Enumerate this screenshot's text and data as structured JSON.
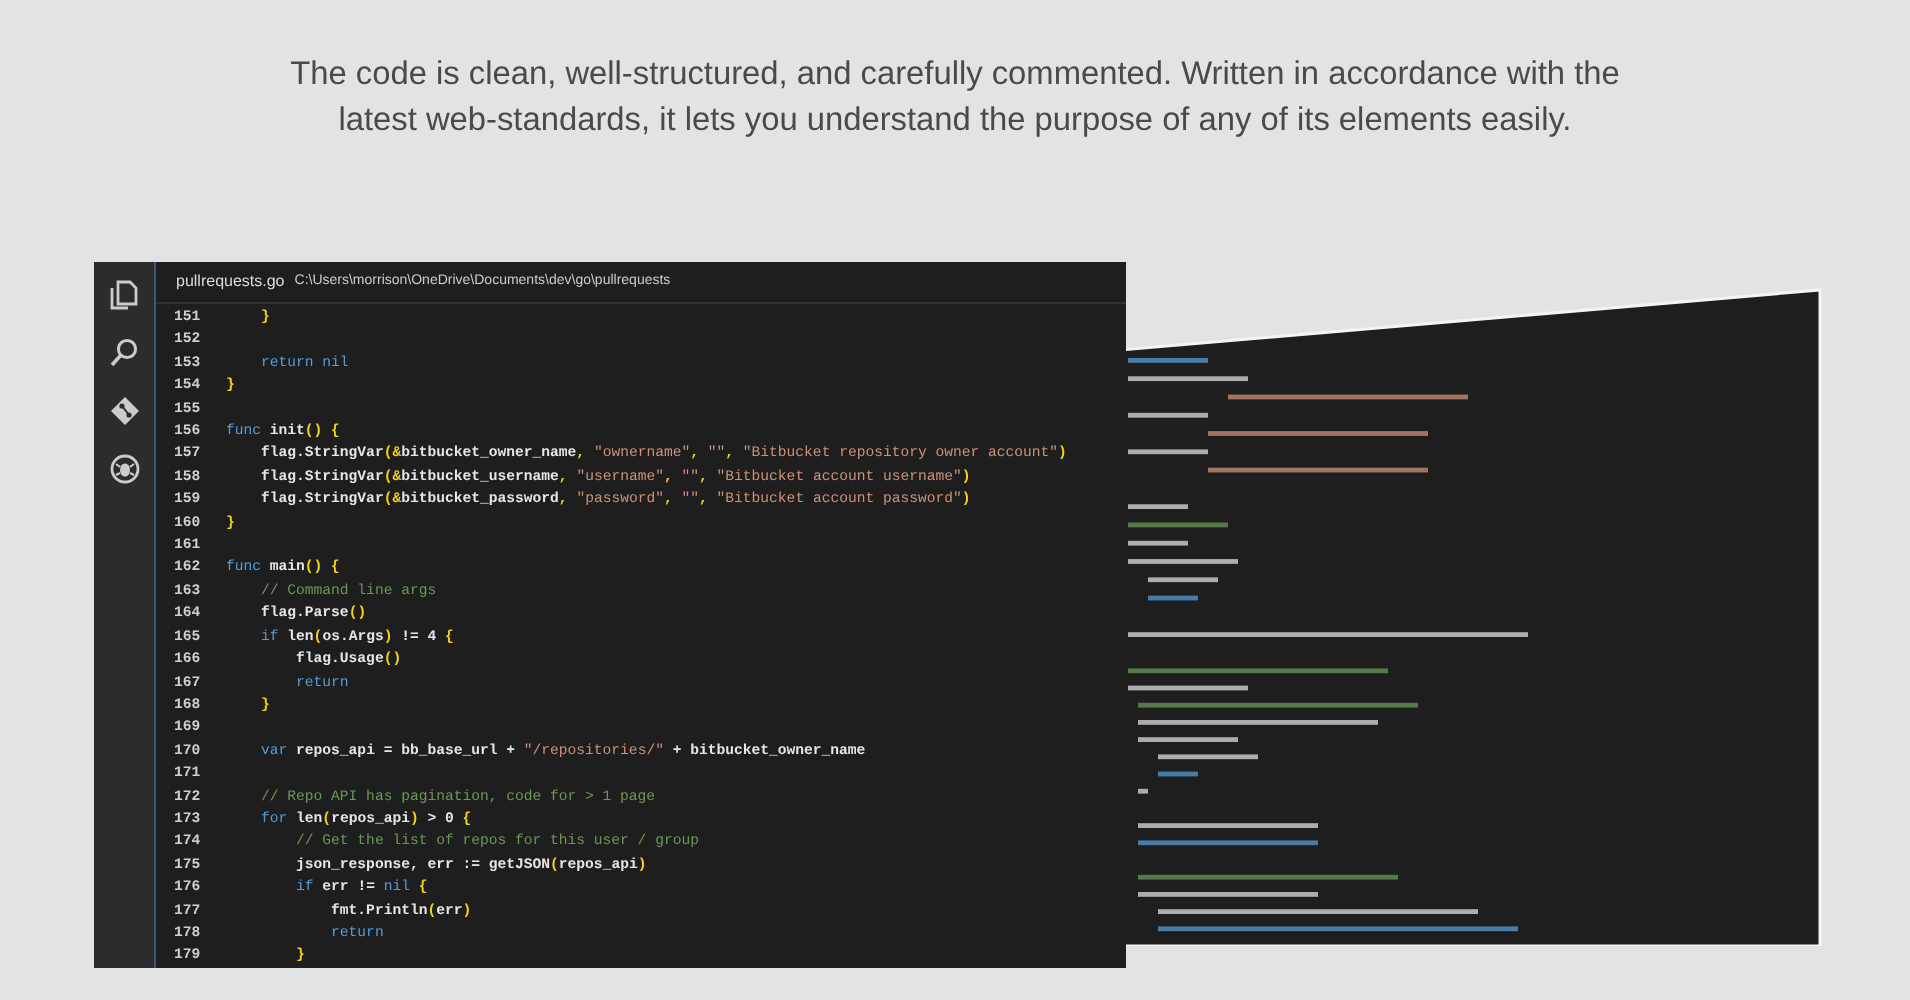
{
  "intro": "The code is clean, well-structured, and carefully commented. Written in accordance with the latest web-standards, it lets you understand the purpose of any of its elements easily.",
  "editor": {
    "file_name": "pullrequests.go",
    "file_path": "C:\\Users\\morrison\\OneDrive\\Documents\\dev\\go\\pullrequests",
    "code_lines": [
      {
        "number": "151",
        "tokens": [
          {
            "kind": "bracket",
            "text": "    }"
          }
        ]
      },
      {
        "number": "152"
      },
      {
        "number": "153",
        "tokens": [
          {
            "kind": "keyword",
            "text": "    return nil"
          }
        ]
      },
      {
        "number": "154",
        "tokens": [
          {
            "kind": "bracket",
            "text": "}"
          }
        ]
      },
      {
        "number": "155"
      },
      {
        "number": "156",
        "tokens": [
          {
            "kind": "keyword",
            "text": "func"
          },
          {
            "kind": "plain",
            "text": " init"
          },
          {
            "kind": "bracket",
            "text": "() {"
          }
        ]
      },
      {
        "number": "157",
        "tokens": [
          {
            "kind": "plain",
            "text": "    flag.StringVar"
          },
          {
            "kind": "bracket",
            "text": "(&"
          },
          {
            "kind": "plain",
            "text": "bitbucket_owner_name"
          },
          {
            "kind": "bracket",
            "text": ", "
          },
          {
            "kind": "string",
            "text": "\"ownername\""
          },
          {
            "kind": "bracket",
            "text": ", "
          },
          {
            "kind": "string",
            "text": "\"\""
          },
          {
            "kind": "bracket",
            "text": ", "
          },
          {
            "kind": "string",
            "text": "\"Bitbucket repository owner account\""
          },
          {
            "kind": "bracket",
            "text": ")"
          }
        ]
      },
      {
        "number": "158",
        "tokens": [
          {
            "kind": "plain",
            "text": "    flag.StringVar"
          },
          {
            "kind": "bracket",
            "text": "(&"
          },
          {
            "kind": "plain",
            "text": "bitbucket_username"
          },
          {
            "kind": "bracket",
            "text": ", "
          },
          {
            "kind": "string",
            "text": "\"username\""
          },
          {
            "kind": "bracket",
            "text": ", "
          },
          {
            "kind": "string",
            "text": "\"\""
          },
          {
            "kind": "bracket",
            "text": ", "
          },
          {
            "kind": "string",
            "text": "\"Bitbucket account username\""
          },
          {
            "kind": "bracket",
            "text": ")"
          }
        ]
      },
      {
        "number": "159",
        "tokens": [
          {
            "kind": "plain",
            "text": "    flag.StringVar"
          },
          {
            "kind": "bracket",
            "text": "(&"
          },
          {
            "kind": "plain",
            "text": "bitbucket_password"
          },
          {
            "kind": "bracket",
            "text": ", "
          },
          {
            "kind": "string",
            "text": "\"password\""
          },
          {
            "kind": "bracket",
            "text": ", "
          },
          {
            "kind": "string",
            "text": "\"\""
          },
          {
            "kind": "bracket",
            "text": ", "
          },
          {
            "kind": "string",
            "text": "\"Bitbucket account password\""
          },
          {
            "kind": "bracket",
            "text": ")"
          }
        ]
      },
      {
        "number": "160",
        "tokens": [
          {
            "kind": "bracket",
            "text": "}"
          }
        ]
      },
      {
        "number": "161"
      },
      {
        "number": "162",
        "tokens": [
          {
            "kind": "keyword",
            "text": "func"
          },
          {
            "kind": "plain",
            "text": " main"
          },
          {
            "kind": "bracket",
            "text": "() {"
          }
        ]
      },
      {
        "number": "163",
        "tokens": [
          {
            "kind": "comment",
            "text": "    // Command line args"
          }
        ]
      },
      {
        "number": "164",
        "tokens": [
          {
            "kind": "plain",
            "text": "    flag.Parse"
          },
          {
            "kind": "bracket",
            "text": "()"
          }
        ]
      },
      {
        "number": "165",
        "tokens": [
          {
            "kind": "keyword",
            "text": "    if"
          },
          {
            "kind": "plain",
            "text": " len"
          },
          {
            "kind": "bracket",
            "text": "("
          },
          {
            "kind": "plain",
            "text": "os.Args"
          },
          {
            "kind": "bracket",
            "text": ")"
          },
          {
            "kind": "plain",
            "text": " != 4 "
          },
          {
            "kind": "bracket",
            "text": "{"
          }
        ]
      },
      {
        "number": "166",
        "tokens": [
          {
            "kind": "plain",
            "text": "        flag.Usage"
          },
          {
            "kind": "bracket",
            "text": "()"
          }
        ]
      },
      {
        "number": "167",
        "tokens": [
          {
            "kind": "keyword",
            "text": "        return"
          }
        ]
      },
      {
        "number": "168",
        "tokens": [
          {
            "kind": "bracket",
            "text": "    }"
          }
        ]
      },
      {
        "number": "169"
      },
      {
        "number": "170",
        "tokens": [
          {
            "kind": "keyword",
            "text": "    var"
          },
          {
            "kind": "plain",
            "text": " repos_api = bb_base_url + "
          },
          {
            "kind": "string",
            "text": "\"/repositories/\""
          },
          {
            "kind": "plain",
            "text": " + bitbucket_owner_name"
          }
        ]
      },
      {
        "number": "171"
      },
      {
        "number": "172",
        "tokens": [
          {
            "kind": "comment",
            "text": "    // Repo API has pagination, code for > 1 page"
          }
        ]
      },
      {
        "number": "173",
        "tokens": [
          {
            "kind": "keyword",
            "text": "    for"
          },
          {
            "kind": "plain",
            "text": " len"
          },
          {
            "kind": "bracket",
            "text": "("
          },
          {
            "kind": "plain",
            "text": "repos_api"
          },
          {
            "kind": "bracket",
            "text": ")"
          },
          {
            "kind": "plain",
            "text": " > 0 "
          },
          {
            "kind": "bracket",
            "text": "{"
          }
        ]
      },
      {
        "number": "174",
        "tokens": [
          {
            "kind": "comment",
            "text": "        // Get the list of repos for this user / group"
          }
        ]
      },
      {
        "number": "175",
        "tokens": [
          {
            "kind": "plain",
            "text": "        json_response, err := getJSON"
          },
          {
            "kind": "bracket",
            "text": "("
          },
          {
            "kind": "plain",
            "text": "repos_api"
          },
          {
            "kind": "bracket",
            "text": ")"
          }
        ]
      },
      {
        "number": "176",
        "tokens": [
          {
            "kind": "keyword",
            "text": "        if"
          },
          {
            "kind": "plain",
            "text": " err != "
          },
          {
            "kind": "keyword",
            "text": "nil"
          },
          {
            "kind": "bracket",
            "text": " {"
          }
        ]
      },
      {
        "number": "177",
        "tokens": [
          {
            "kind": "plain",
            "text": "            fmt.Println"
          },
          {
            "kind": "bracket",
            "text": "("
          },
          {
            "kind": "plain",
            "text": "err"
          },
          {
            "kind": "bracket",
            "text": ")"
          }
        ]
      },
      {
        "number": "178",
        "tokens": [
          {
            "kind": "keyword",
            "text": "            return"
          }
        ]
      },
      {
        "number": "179",
        "tokens": [
          {
            "kind": "bracket",
            "text": "        }"
          }
        ]
      }
    ]
  }
}
